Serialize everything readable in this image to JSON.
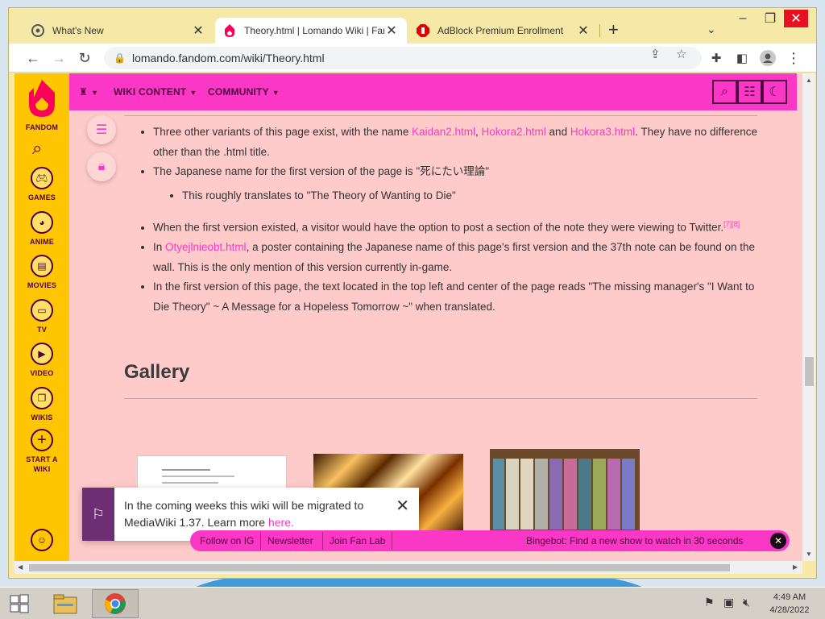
{
  "browser": {
    "tabs": [
      {
        "title": "What's New",
        "active": false
      },
      {
        "title": "Theory.html | Lomando Wiki | Fandom",
        "active": true
      },
      {
        "title": "AdBlock Premium Enrollment",
        "active": false
      }
    ],
    "new_tab": "+",
    "url": "lomando.fandom.com/wiki/Theory.html"
  },
  "fandom_rail": {
    "brand": "FANDOM",
    "items": [
      {
        "label": "GAMES",
        "icon": "gamepad-icon"
      },
      {
        "label": "ANIME",
        "icon": "anime-face-icon"
      },
      {
        "label": "MOVIES",
        "icon": "clapper-icon"
      },
      {
        "label": "TV",
        "icon": "tv-icon"
      },
      {
        "label": "VIDEO",
        "icon": "play-icon"
      },
      {
        "label": "WIKIS",
        "icon": "book-icon"
      }
    ],
    "start_wiki": "START A WIKI"
  },
  "wiki_nav": {
    "wiki_content": "WIKI CONTENT",
    "community": "COMMUNITY"
  },
  "article": {
    "b1_pre": "Three other variants of this page exist, with the name ",
    "b1_link1": "Kaidan2.html",
    "b1_sep1": ", ",
    "b1_link2": "Hokora2.html",
    "b1_sep2": " and ",
    "b1_link3": "Hokora3.html",
    "b1_post": ". They have no difference other than the .html title.",
    "b2": "The Japanese name for the first version of the page is \"死にたい理論\"",
    "b2_sub": "This roughly translates to \"The Theory of Wanting to Die\"",
    "b3": "When the first version existed, a visitor would have the option to post a section of the note they were viewing to Twitter.",
    "b3_refs": "[7][8]",
    "b4_pre": "In ",
    "b4_link": "Otyejlnieobt.html",
    "b4_post": ", a poster containing the Japanese name of this page's first version and the 37th note can be found on the wall. This is the only mention of this version currently in-game.",
    "b5": "In the first version of this page, the text located in the top left and center of the page reads \"The missing manager's \"I Want to Die Theory\" ~ A Message for a Hopeless Tomorrow ~\" when translated.",
    "gallery_heading": "Gallery"
  },
  "toast": {
    "message": "In the coming weeks this wiki will be migrated to MediaWiki 1.37. Learn more ",
    "link": "here."
  },
  "fan_bar": {
    "items": [
      "Follow on IG",
      "Newsletter",
      "Join Fan Lab"
    ],
    "promo": "Bingebot: Find a new show to watch in 30 seconds"
  },
  "taskbar": {
    "time": "4:49 AM",
    "date": "4/28/2022"
  },
  "colors": {
    "fandom_yellow": "#fec600",
    "wiki_pink": "#fa38c5",
    "page_bg": "#ffcaca",
    "dark_plum": "#520044"
  }
}
